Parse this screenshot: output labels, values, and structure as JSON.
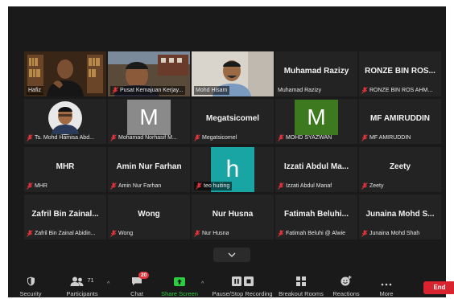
{
  "participants": [
    {
      "label": "Hafiz",
      "big": "",
      "kind": "video",
      "active": true,
      "muted": false
    },
    {
      "label": "Pusat Kemajuan Kerjay...",
      "big": "",
      "kind": "video",
      "active": false,
      "muted": true
    },
    {
      "label": "Mohd Hisam",
      "big": "",
      "kind": "video",
      "active": false,
      "muted": false
    },
    {
      "label": "Muhamad Razizy",
      "big": "Muhamad Razizy",
      "kind": "name",
      "active": false,
      "muted": false
    },
    {
      "label": "RONZE BIN ROS AHM...",
      "big": "RONZE BIN ROS...",
      "kind": "name",
      "active": false,
      "muted": true
    },
    {
      "label": "Ts. Mohd Hamisa Abd...",
      "big": "",
      "kind": "photo",
      "active": false,
      "muted": true
    },
    {
      "label": "Mohamad Norhasif M...",
      "big": "",
      "kind": "letter",
      "letter": "M",
      "color": "#8a8a8a",
      "active": false,
      "muted": true
    },
    {
      "label": "Megatsicomel",
      "big": "Megatsicomel",
      "kind": "name",
      "active": false,
      "muted": true
    },
    {
      "label": "MOHD SYAZWAN",
      "big": "",
      "kind": "letter",
      "letter": "M",
      "color": "#3d7a1f",
      "active": false,
      "muted": true
    },
    {
      "label": "MF AMIRUDDIN",
      "big": "MF AMIRUDDIN",
      "kind": "name",
      "active": false,
      "muted": true
    },
    {
      "label": "MHR",
      "big": "MHR",
      "kind": "name",
      "active": false,
      "muted": true
    },
    {
      "label": "Amin Nur Farhan",
      "big": "Amin Nur Farhan",
      "kind": "name",
      "active": false,
      "muted": true
    },
    {
      "label": "teo huiting",
      "big": "",
      "kind": "letter-h",
      "letter": "h",
      "color": "#1aa5a5",
      "active": false,
      "muted": true
    },
    {
      "label": "Izzati Abdul Manaf",
      "big": "Izzati Abdul Ma...",
      "kind": "name",
      "active": false,
      "muted": true
    },
    {
      "label": "Zeety",
      "big": "Zeety",
      "kind": "name",
      "active": false,
      "muted": true
    },
    {
      "label": "Zafril Bin Zainal Abidin...",
      "big": "Zafril Bin Zainal...",
      "kind": "name",
      "active": false,
      "muted": true
    },
    {
      "label": "Wong",
      "big": "Wong",
      "kind": "name",
      "active": false,
      "muted": true
    },
    {
      "label": "Nur Husna",
      "big": "Nur Husna",
      "kind": "name",
      "active": false,
      "muted": true
    },
    {
      "label": "Fatimah Beluhi @ Alwie",
      "big": "Fatimah Beluhi...",
      "kind": "name",
      "active": false,
      "muted": true
    },
    {
      "label": "Junaina Mohd Shah",
      "big": "Junaina Mohd S...",
      "kind": "name",
      "active": false,
      "muted": true
    }
  ],
  "toolbar": {
    "security": "Security",
    "participants": "Participants",
    "participants_count": "71",
    "chat": "Chat",
    "chat_badge": "20",
    "share_screen": "Share Screen",
    "recording": "Pause/Stop Recording",
    "breakout": "Breakout Rooms",
    "reactions": "Reactions",
    "more": "More",
    "end": "End"
  },
  "colors": {
    "active_border": "#cde64a",
    "share_green": "#2ecc40",
    "end_red": "#d9242f",
    "mute_red": "#e0353b"
  }
}
